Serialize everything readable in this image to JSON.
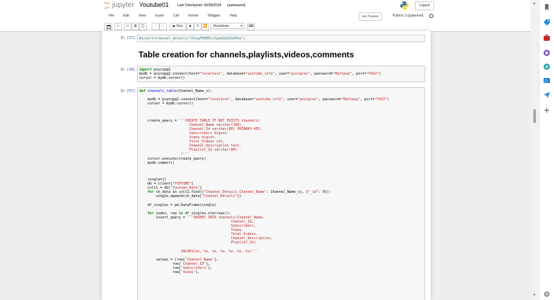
{
  "header": {
    "logo_text": "jupyter",
    "notebook_name": "Youtube01",
    "checkpoint": "Last Checkpoint: 05/09/2024",
    "autosaved": "(autosaved)",
    "logout_label": "Logout"
  },
  "menu": {
    "items": [
      "File",
      "Edit",
      "View",
      "Insert",
      "Cell",
      "Kernel",
      "Widgets",
      "Help"
    ],
    "trust_label": "Not Trusted",
    "kernel_name": "Python 3 (ipykernel)"
  },
  "toolbar": {
    "run_label": "Run",
    "cell_type": "Markdown",
    "buttons": [
      "save-icon",
      "add-cell-icon",
      "cut-icon",
      "copy-icon",
      "paste-icon",
      "move-up-icon",
      "move-down-icon",
      "run-icon",
      "stop-icon",
      "restart-icon",
      "restart-run-all-icon",
      "keyboard-icon"
    ]
  },
  "cells": [
    {
      "prompt": "In [17]:",
      "code": "#insert=channel_details(\"UCuqFB9MKLtSpmXZaUSSXHnw\")"
    },
    {
      "markdown_heading": "Table creation for channels,playlists,videos,comments"
    },
    {
      "prompt": "In [18]:",
      "code": "import psycopg2\nmydb = psycopg2.connect(host=\"localhost\", database=\"youtube_info\", user=\"postgres\", password=\"Mattpop\", port=\"5432\")\ncursor = mydb.cursor()"
    },
    {
      "prompt": "In [67]:",
      "code": "def channels_table(Channel_Name_s):\n\n    mydb = psycopg2.connect(host=\"localhost\", database=\"youtube_info\", user=\"postgres\", password=\"Mattpop\", port=\"5432\")\n    cursor = mydb.cursor()\n\n\n\n    create_query = '''CREATE TABLE IF NOT EXISTS channels(\n                        Channel_Name varchar(100),\n                        Channel_Id varchar(80) PRIMARY KEY,\n                        Subscribers bigint,\n                        Views bigint,\n                        Total_Videos int,\n                        Channel_Description text,\n                        Playlist_Id varchar(80)\n                    )'''\n    cursor.execute(create_query)\n    mydb.commit()\n\n\n\n    single=[]\n    db = client[\"YOUTUBE\"]\n    coll1 = db[\"Youtube_Data\"]\n    for ch_data in coll1.find({\"Channel_Details.Channel_Name\": Channel_Name_s}, {\"_id\": 0}):\n        single.append(ch_data[\"Channel_Details\"])\n\n    df_singles = pd.DataFrame(single)\n\n    for index, row in df_singles.iterrows():\n        insert_query = '''INSERT INTO channels(Channel_Name,\n                                            Channel_Id,\n                                            Subscribers,\n                                            Views,\n                                            Total_Videos,\n                                            Channel_Description,\n                                            Playlist_Id)\n                                            \n                    VALUES(%s, %s, %s, %s, %s, %s, %s)'''\n\n        values = (row['Channel_Name'],\n                row['Channel_Id'],\n                row['Subscribers'],\n                row['Views'],"
    }
  ],
  "sidebar_icons": [
    "bookmark-icon",
    "tag-icon",
    "briefcase-icon",
    "chrome-icon",
    "copilot-icon",
    "outlook-icon",
    "paper-plane-icon",
    "plus-icon",
    "settings-icon"
  ]
}
